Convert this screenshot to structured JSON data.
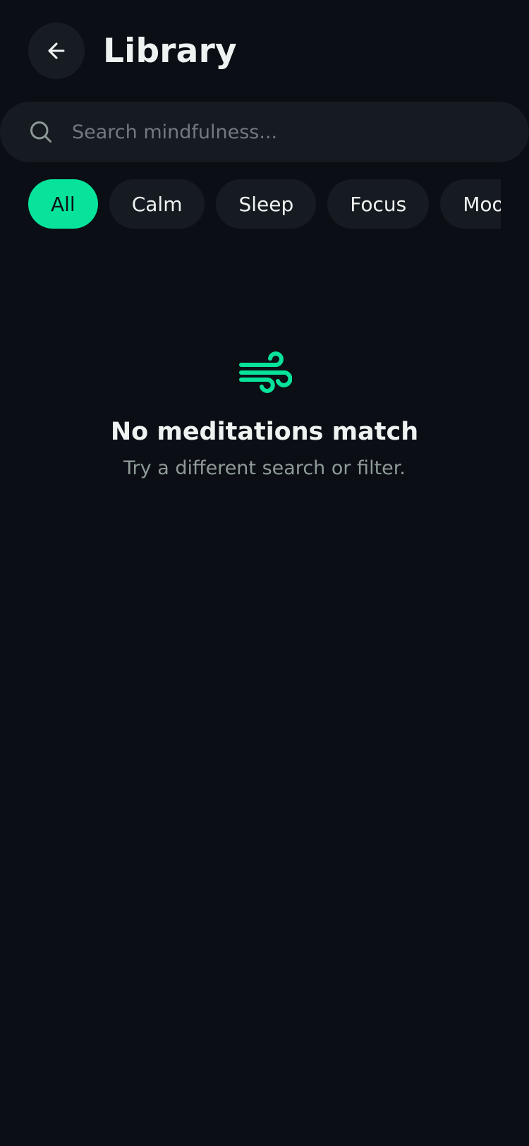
{
  "header": {
    "title": "Library"
  },
  "search": {
    "placeholder": "Search mindfulness...",
    "value": ""
  },
  "filters": {
    "chips": [
      {
        "label": "All",
        "active": true
      },
      {
        "label": "Calm",
        "active": false
      },
      {
        "label": "Sleep",
        "active": false
      },
      {
        "label": "Focus",
        "active": false
      },
      {
        "label": "Mood",
        "active": false
      }
    ]
  },
  "empty_state": {
    "icon": "wind-icon",
    "title": "No meditations match",
    "subtitle": "Try a different search or filter."
  },
  "colors": {
    "background": "#0b0f15",
    "surface": "#151b20",
    "accent": "#07e39a",
    "text": "#eef3f1",
    "muted": "#8f9b98"
  }
}
